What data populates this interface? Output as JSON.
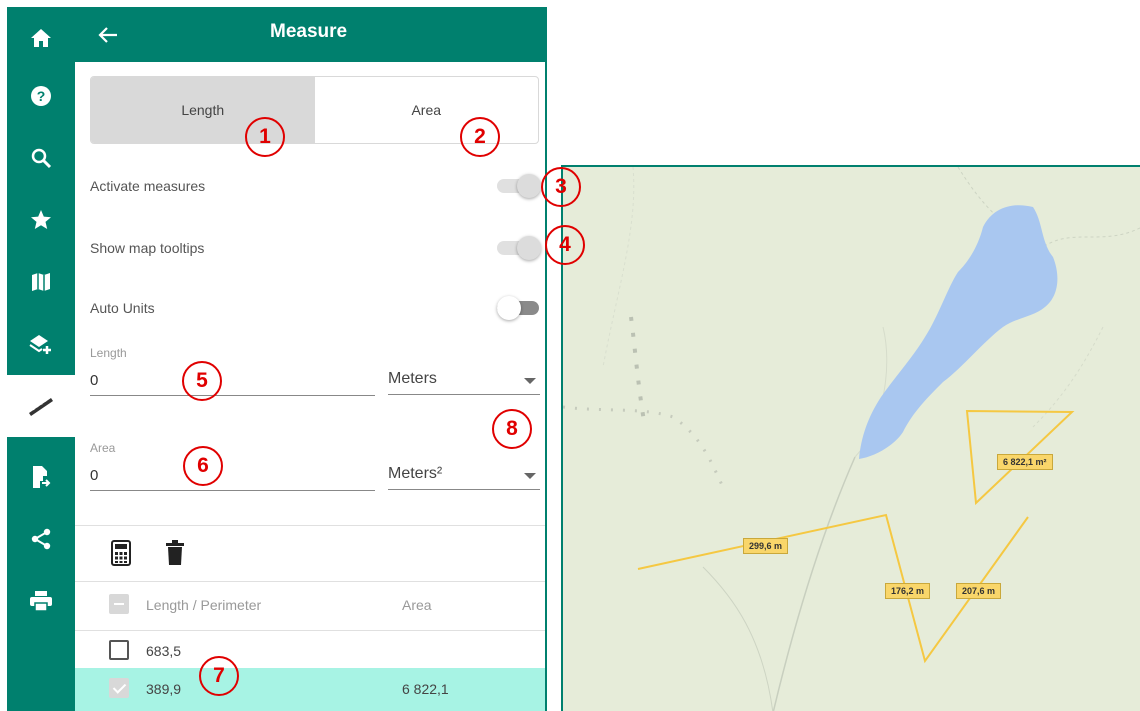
{
  "panel": {
    "title": "Measure",
    "tabs": [
      {
        "label": "Length",
        "active": true
      },
      {
        "label": "Area",
        "active": false
      }
    ],
    "toggles": [
      {
        "label": "Activate measures",
        "state": "on"
      },
      {
        "label": "Show map tooltips",
        "state": "on"
      },
      {
        "label": "Auto Units",
        "state": "off"
      }
    ],
    "length_field": {
      "label": "Length",
      "value": "0",
      "unit": "Meters"
    },
    "area_field": {
      "label": "Area",
      "value": "0",
      "unit": "Meters²"
    },
    "table": {
      "headers": [
        "Length / Perimeter",
        "Area"
      ],
      "rows": [
        {
          "length": "683,5",
          "area": "",
          "checked": false
        },
        {
          "length": "389,9",
          "area": "6 822,1",
          "checked": true
        }
      ]
    }
  },
  "rail_icons": [
    "home-icon",
    "help-icon",
    "search-icon",
    "star-icon",
    "map-icon",
    "add-layer-icon",
    "ruler-icon",
    "export-file-icon",
    "share-icon",
    "print-icon"
  ],
  "active_rail_icon": "ruler-icon",
  "callouts": [
    "1",
    "2",
    "3",
    "4",
    "5",
    "6",
    "7",
    "8"
  ],
  "map_labels": {
    "area_label": "6 822,1 m²",
    "seg1": "299,6 m",
    "seg2": "176,2 m",
    "seg3": "207,6 m"
  },
  "colors": {
    "brand": "#00806e",
    "selected_row": "#a7f3e4",
    "callout": "#e00000",
    "measure_line": "#f5c842",
    "lake": "#a9c7f0"
  }
}
